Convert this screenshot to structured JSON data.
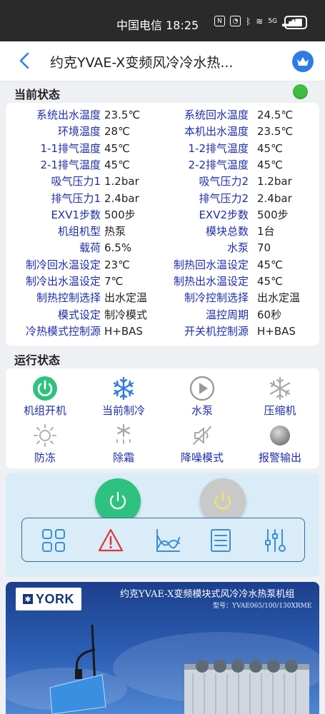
{
  "status_bar": {
    "carrier_time": "中国电信 18:25",
    "network": "5G",
    "battery": "49"
  },
  "header": {
    "title": "约克YVAE-X变频风冷冷水热..."
  },
  "current_status": {
    "section_label": "当前状态",
    "indicator_color": "#3fbf3f",
    "rows": [
      {
        "l_label": "系统出水温度",
        "l_value": "23.5℃",
        "r_label": "系统回水温度",
        "r_value": "24.5℃"
      },
      {
        "l_label": "环境温度",
        "l_value": "28℃",
        "r_label": "本机出水温度",
        "r_value": "23.5℃"
      },
      {
        "l_label": "1-1排气温度",
        "l_value": "45℃",
        "r_label": "1-2排气温度",
        "r_value": "45℃"
      },
      {
        "l_label": "2-1排气温度",
        "l_value": "45℃",
        "r_label": "2-2排气温度",
        "r_value": "45℃"
      },
      {
        "l_label": "吸气压力1",
        "l_value": "1.2bar",
        "r_label": "吸气压力2",
        "r_value": "1.2bar"
      },
      {
        "l_label": "排气压力1",
        "l_value": "2.4bar",
        "r_label": "排气压力2",
        "r_value": "2.4bar"
      },
      {
        "l_label": "EXV1步数",
        "l_value": "500步",
        "r_label": "EXV2步数",
        "r_value": "500步"
      },
      {
        "l_label": "机组机型",
        "l_value": "热泵",
        "r_label": "模块总数",
        "r_value": "1台"
      },
      {
        "l_label": "载荷",
        "l_value": "6.5%",
        "r_label": "水泵",
        "r_value": "70"
      },
      {
        "l_label": "制冷回水温设定",
        "l_value": "23℃",
        "r_label": "制热回水温设定",
        "r_value": "45℃"
      },
      {
        "l_label": "制冷出水温设定",
        "l_value": "7℃",
        "r_label": "制热出水温设定",
        "r_value": "45℃"
      },
      {
        "l_label": "制热控制选择",
        "l_value": "出水定温",
        "r_label": "制冷控制选择",
        "r_value": "出水定温"
      },
      {
        "l_label": "模式设定",
        "l_value": "制冷模式",
        "r_label": "温控周期",
        "r_value": "60秒"
      },
      {
        "l_label": "冷热模式控制源",
        "l_value": "H+BAS",
        "r_label": "开关机控制源",
        "r_value": "H+BAS"
      }
    ]
  },
  "running_state": {
    "section_label": "运行状态",
    "items": [
      {
        "label": "机组开机",
        "icon": "power-icon",
        "active": true
      },
      {
        "label": "当前制冷",
        "icon": "snowflake-icon",
        "active": true
      },
      {
        "label": "水泵",
        "icon": "pump-play-icon",
        "active": false
      },
      {
        "label": "压缩机",
        "icon": "compressor-snowflake-icon",
        "active": false
      },
      {
        "label": "防冻",
        "icon": "sun-icon",
        "active": false
      },
      {
        "label": "除霜",
        "icon": "defrost-icon",
        "active": false
      },
      {
        "label": "降噪模式",
        "icon": "mute-icon",
        "active": false
      },
      {
        "label": "报警输出",
        "icon": "alarm-light-icon",
        "active": false
      }
    ]
  },
  "controls": {
    "power_on_color": "#2ec27e",
    "power_off_color": "#c9c9c9",
    "toolbar_icons": [
      "grid-icon",
      "warning-icon",
      "trend-chart-icon",
      "list-icon",
      "settings-sliders-icon"
    ]
  },
  "banner": {
    "brand": "YORK",
    "title": "约克YVAE-X变频模块式风冷冷水热泵机组",
    "model": "型号：YVAE065/100/130XRME"
  }
}
